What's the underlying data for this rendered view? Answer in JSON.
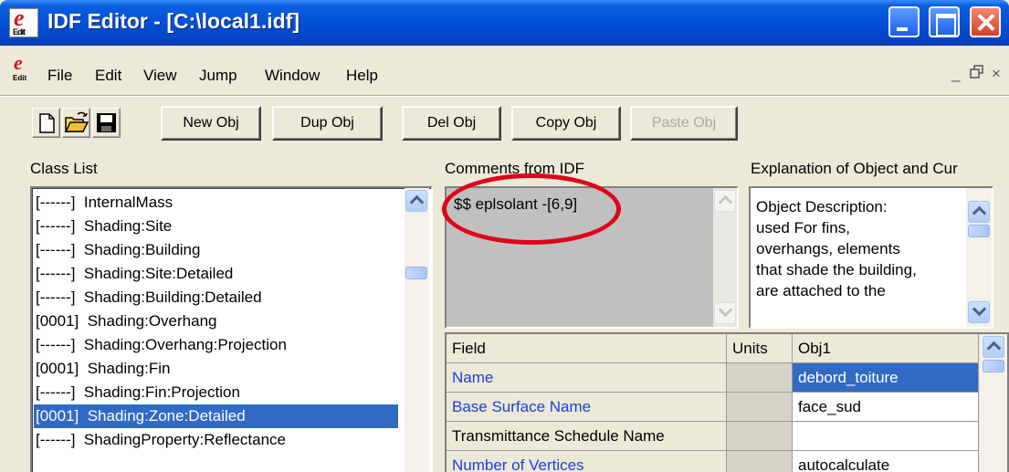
{
  "window": {
    "title": "IDF Editor - [C:\\local1.idf]",
    "logo_letter": "e",
    "logo_sub": "Edit"
  },
  "menu": [
    "File",
    "Edit",
    "View",
    "Jump",
    "Window",
    "Help"
  ],
  "mdi_controls": [
    "_",
    "ƒ",
    "×"
  ],
  "toolbar": {
    "icons": [
      "new-file-icon",
      "open-folder-icon",
      "save-disk-icon"
    ],
    "buttons": [
      {
        "label": "New Obj",
        "enabled": true
      },
      {
        "label": "Dup Obj",
        "enabled": true
      },
      {
        "label": "Del Obj",
        "enabled": true
      },
      {
        "label": "Copy Obj",
        "enabled": true
      },
      {
        "label": "Paste Obj",
        "enabled": false
      }
    ]
  },
  "class_list": {
    "label": "Class List",
    "items": [
      "[------]  InternalMass",
      "[------]  Shading:Site",
      "[------]  Shading:Building",
      "[------]  Shading:Site:Detailed",
      "[------]  Shading:Building:Detailed",
      "[0001]  Shading:Overhang",
      "[------]  Shading:Overhang:Projection",
      "[0001]  Shading:Fin",
      "[------]  Shading:Fin:Projection",
      "[0001]  Shading:Zone:Detailed",
      "[------]  ShadingProperty:Reflectance"
    ],
    "selected_index": 9
  },
  "comments": {
    "label": "Comments from IDF",
    "text": "$$ eplsolant -[6,9]",
    "highlight_color": "#e0001a"
  },
  "explanation": {
    "label": "Explanation of Object and Cur",
    "lines": [
      "Object Description:",
      "used For fins,",
      "overhangs, elements",
      "that shade the building,",
      "are attached to the"
    ]
  },
  "grid": {
    "headers": [
      "Field",
      "Units",
      "Obj1"
    ],
    "rows": [
      {
        "field": "Name",
        "units": "",
        "value": "debord_toiture",
        "required": true,
        "selected": true
      },
      {
        "field": "Base Surface Name",
        "units": "",
        "value": "face_sud",
        "required": true,
        "selected": false
      },
      {
        "field": "Transmittance Schedule Name",
        "units": "",
        "value": "",
        "required": false,
        "selected": false
      },
      {
        "field": "Number of Vertices",
        "units": "",
        "value": "autocalculate",
        "required": true,
        "selected": false
      }
    ]
  },
  "colors": {
    "titlebar": "#0450d8",
    "selection": "#316ac5",
    "required_field": "#1d40d8"
  }
}
